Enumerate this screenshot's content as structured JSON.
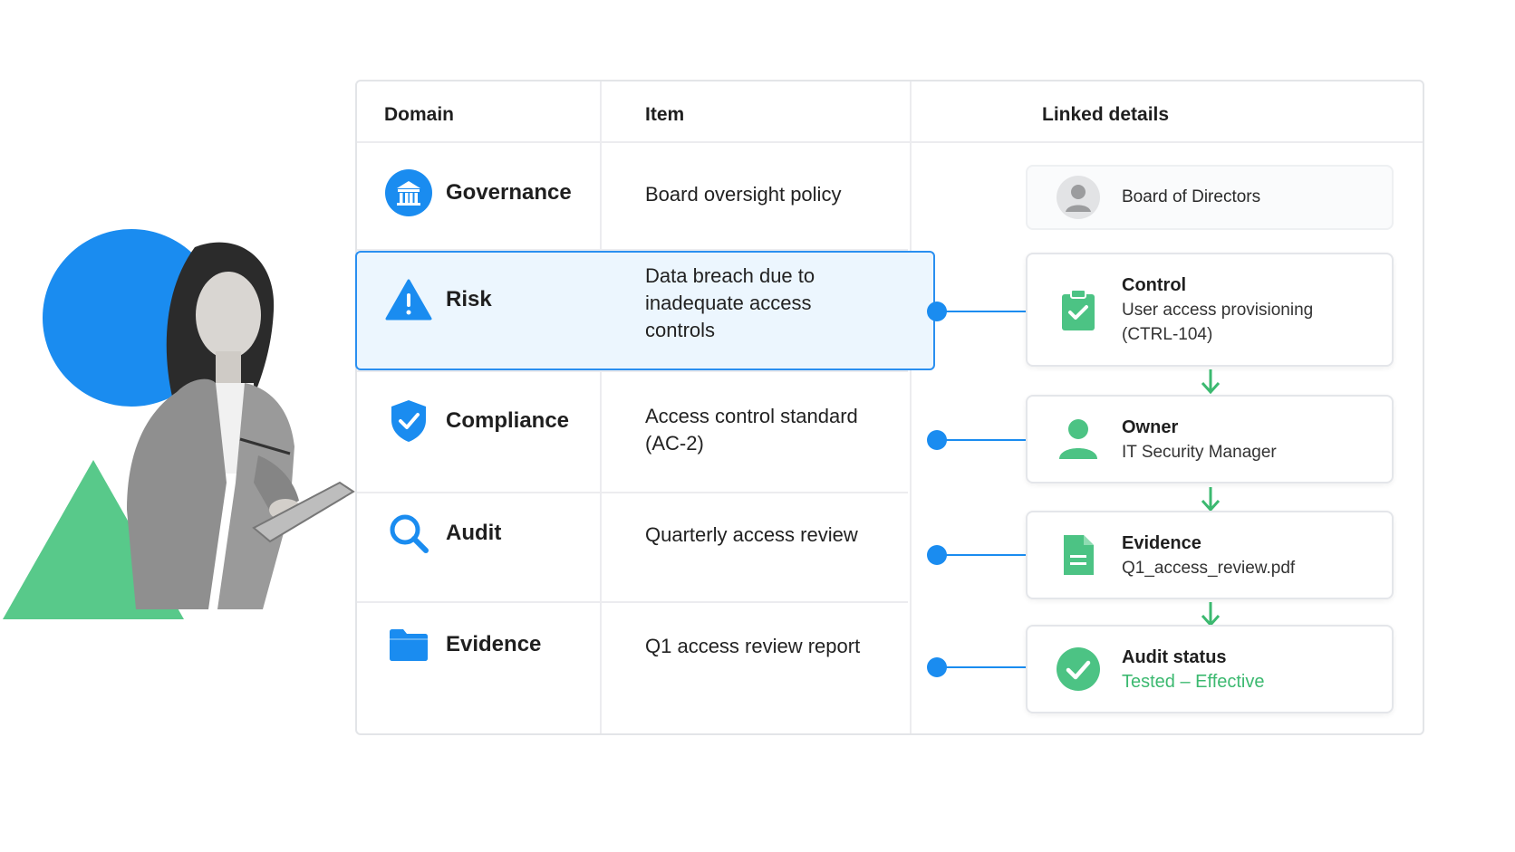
{
  "table": {
    "headers": {
      "domain": "Domain",
      "item": "Item",
      "linked": "Linked details"
    },
    "rows": [
      {
        "domain": "Governance",
        "icon": "bank-icon",
        "item": "Board oversight policy"
      },
      {
        "domain": "Risk",
        "icon": "warning-icon",
        "item": "Data breach due to inadequate access controls",
        "highlighted": true
      },
      {
        "domain": "Compliance",
        "icon": "shield-check-icon",
        "item": "Access control standard (AC-2)"
      },
      {
        "domain": "Audit",
        "icon": "search-icon",
        "item": "Quarterly access review"
      },
      {
        "domain": "Evidence",
        "icon": "folder-icon",
        "item": "Q1 access review report"
      }
    ]
  },
  "linked_details": {
    "board": {
      "label": "Board of Directors",
      "icon": "avatar-icon"
    },
    "control": {
      "title": "Control",
      "sub": "User access provisioning (CTRL-104)",
      "icon": "clipboard-check-icon"
    },
    "owner": {
      "title": "Owner",
      "sub": "IT Security Manager",
      "icon": "person-icon"
    },
    "evidence": {
      "title": "Evidence",
      "sub": "Q1_access_review.pdf",
      "icon": "document-icon"
    },
    "audit_status": {
      "title": "Audit status",
      "sub": "Tested – Effective",
      "icon": "check-circle-icon"
    }
  },
  "colors": {
    "accent": "#1a8cf0",
    "green": "#3cb970",
    "highlight_bg": "#ecf6fe"
  }
}
